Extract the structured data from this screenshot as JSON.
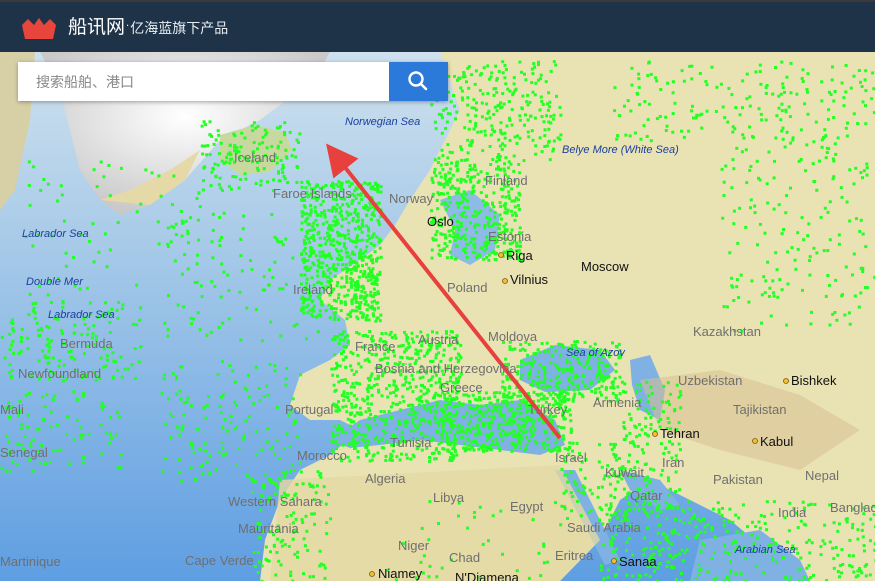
{
  "header": {
    "site_name": "船讯网",
    "separator": "·",
    "tagline": "亿海蓝旗下产品"
  },
  "search": {
    "placeholder": "搜索船舶、港口",
    "value": "",
    "button_icon": "search-icon"
  },
  "map": {
    "seas": [
      "Norwegian Sea",
      "Belye More (White Sea)",
      "Labrador Sea",
      "Labrador Sea",
      "Double Mer",
      "Sea of Azov",
      "Arabian Sea"
    ],
    "countries": [
      "Iceland",
      "Faroe Islands",
      "Norway",
      "Finland",
      "Estonia",
      "Poland",
      "Ireland",
      "France",
      "Austria",
      "Moldova",
      "Bosnia and Herzegovina",
      "Greece",
      "Portugal",
      "Turkey",
      "Armenia",
      "Tunisia",
      "Morocco",
      "Algeria",
      "Libya",
      "Egypt",
      "Israel",
      "Kuwait",
      "Iran",
      "Qatar",
      "Saudi Arabia",
      "Western Sahara",
      "Mauritania",
      "Niger",
      "Chad",
      "Eritrea",
      "Cape Verde",
      "Kazakhstan",
      "Uzbekistan",
      "Tajikistan",
      "Pakistan",
      "Nepal",
      "India",
      "Bangladesh",
      "Mali",
      "Senegal",
      "Martinique",
      "Bermuda",
      "Newfoundland"
    ],
    "cities": [
      "Oslo",
      "Riga",
      "Vilnius",
      "Moscow",
      "Bishkek",
      "Tehran",
      "Kabul",
      "Sanaa",
      "Niamey",
      "N'Djamena"
    ],
    "colors": {
      "water": "#7fb1e3",
      "land": "#e9e3b4",
      "ships": "#22ff22",
      "arrow": "#e8403d",
      "header": "#1f3348",
      "button": "#2b79d8"
    }
  }
}
